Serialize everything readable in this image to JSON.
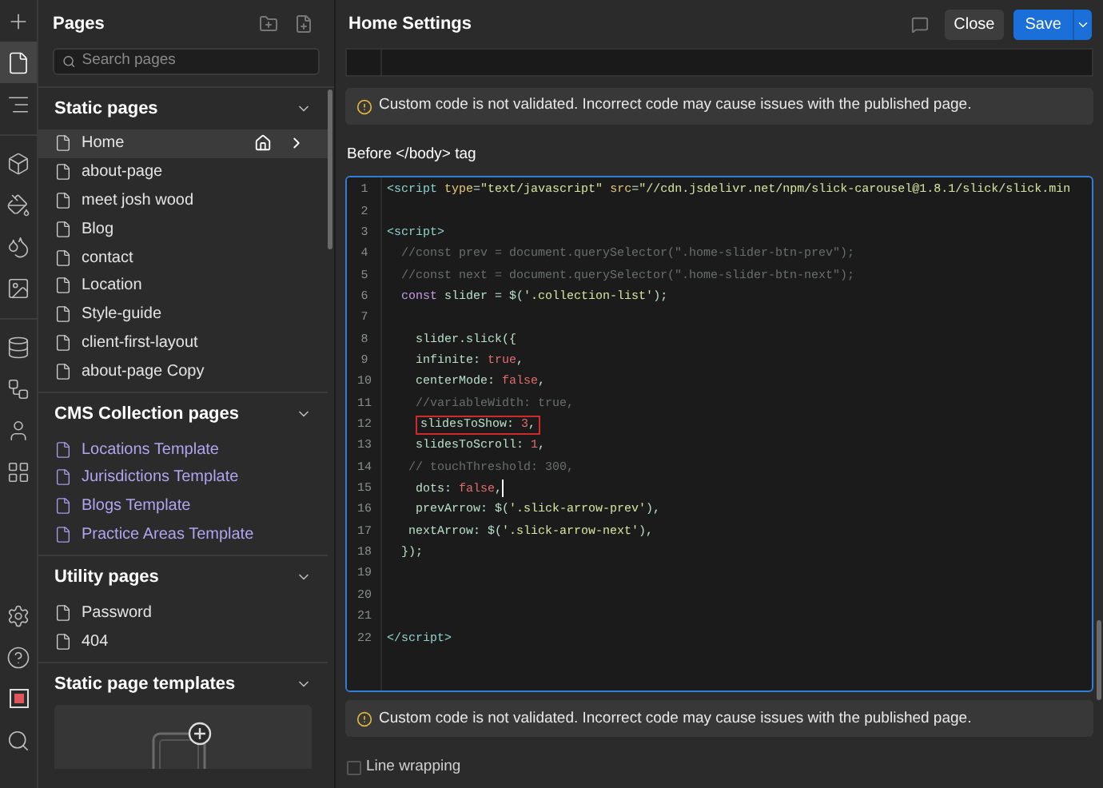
{
  "rail": [
    {
      "selected": false
    },
    {
      "selected": true
    },
    {
      "selected": false
    },
    {
      "selected": false
    },
    {
      "selected": false
    },
    {
      "selected": false
    },
    {
      "selected": false
    },
    {
      "selected": false
    },
    {
      "selected": false
    },
    {
      "selected": false
    },
    {
      "selected": false
    },
    {
      "selected": false
    },
    {
      "selected": false
    },
    {
      "selected": false
    },
    {
      "selected": false
    }
  ],
  "pages_panel": {
    "title": "Pages",
    "search": {
      "placeholder": "Search pages"
    },
    "sections": [
      {
        "title": "Static pages",
        "kind": "static",
        "items": [
          {
            "label": "Home",
            "selected": true
          },
          {
            "label": "about-page",
            "selected": false
          },
          {
            "label": "meet josh wood",
            "selected": false
          },
          {
            "label": "Blog",
            "selected": false
          },
          {
            "label": "contact",
            "selected": false
          },
          {
            "label": "Location",
            "selected": false
          },
          {
            "label": "Style-guide",
            "selected": false
          },
          {
            "label": "client-first-layout",
            "selected": false
          },
          {
            "label": "about-page Copy",
            "selected": false
          }
        ]
      },
      {
        "title": "CMS Collection pages",
        "kind": "cms",
        "items": [
          {
            "label": "Locations Template",
            "selected": false
          },
          {
            "label": "Jurisdictions Template",
            "selected": false
          },
          {
            "label": "Blogs Template",
            "selected": false
          },
          {
            "label": "Practice Areas Template",
            "selected": false
          }
        ]
      },
      {
        "title": "Utility pages",
        "kind": "static",
        "items": [
          {
            "label": "Password",
            "selected": false
          },
          {
            "label": "404",
            "selected": false
          }
        ]
      },
      {
        "title": "Static page templates",
        "kind": "templates"
      }
    ]
  },
  "settings": {
    "title": "Home Settings",
    "buttons": {
      "close": "Close",
      "save": "Save"
    },
    "top_notice": "Custom code is not validated. Incorrect code may cause issues with the published page.",
    "section_label": "Before </body> tag",
    "code_lines": [
      {
        "n": "1",
        "highlighted": false,
        "cursor": false,
        "tokens": [
          {
            "kind": "tag",
            "text": "<script "
          },
          {
            "kind": "attr",
            "text": "type"
          },
          {
            "kind": "plain",
            "text": "="
          },
          {
            "kind": "str",
            "text": "\"text/javascript\" "
          },
          {
            "kind": "attr",
            "text": "src"
          },
          {
            "kind": "plain",
            "text": "="
          },
          {
            "kind": "str",
            "text": "\"//cdn.jsdelivr.net/npm/slick-carousel@1.8.1/slick/slick.min"
          }
        ]
      },
      {
        "n": "2",
        "highlighted": false,
        "cursor": false
      },
      {
        "n": "3",
        "highlighted": false,
        "cursor": false,
        "tokens": [
          {
            "kind": "tag",
            "text": "<script>"
          }
        ]
      },
      {
        "n": "4",
        "highlighted": false,
        "cursor": false,
        "tokens": [
          {
            "kind": "comment",
            "text": "  //const prev = document.querySelector(\".home-slider-btn-prev\");"
          }
        ]
      },
      {
        "n": "5",
        "highlighted": false,
        "cursor": false,
        "tokens": [
          {
            "kind": "comment",
            "text": "  //const next = document.querySelector(\".home-slider-btn-next\");"
          }
        ]
      },
      {
        "n": "6",
        "highlighted": false,
        "cursor": false,
        "tokens": [
          {
            "kind": "keyword",
            "text": "  const"
          },
          {
            "kind": "plain",
            "text": " slider = $("
          },
          {
            "kind": "str",
            "text": "'.collection-list'"
          },
          {
            "kind": "plain",
            "text": ");"
          }
        ]
      },
      {
        "n": "7",
        "highlighted": false,
        "cursor": false
      },
      {
        "n": "8",
        "highlighted": false,
        "cursor": false,
        "tokens": [
          {
            "kind": "plain",
            "text": "    slider.slick({"
          }
        ]
      },
      {
        "n": "9",
        "highlighted": false,
        "cursor": false,
        "tokens": [
          {
            "kind": "plain",
            "text": "    infinite: "
          },
          {
            "kind": "bool",
            "text": "true"
          },
          {
            "kind": "plain",
            "text": ","
          }
        ]
      },
      {
        "n": "10",
        "highlighted": false,
        "cursor": false,
        "tokens": [
          {
            "kind": "plain",
            "text": "    centerMode: "
          },
          {
            "kind": "bool",
            "text": "false"
          },
          {
            "kind": "plain",
            "text": ","
          }
        ]
      },
      {
        "n": "11",
        "highlighted": false,
        "cursor": false,
        "tokens": [
          {
            "kind": "comment",
            "text": "    //variableWidth: true,"
          }
        ]
      },
      {
        "n": "12",
        "highlighted": true,
        "cursor": false,
        "tokens": [
          {
            "kind": "plain",
            "text": "    slidesToShow: "
          },
          {
            "kind": "num",
            "text": "3"
          },
          {
            "kind": "plain",
            "text": ","
          }
        ]
      },
      {
        "n": "13",
        "highlighted": false,
        "cursor": false,
        "tokens": [
          {
            "kind": "plain",
            "text": "    slidesToScroll: "
          },
          {
            "kind": "num",
            "text": "1"
          },
          {
            "kind": "plain",
            "text": ","
          }
        ]
      },
      {
        "n": "14",
        "highlighted": false,
        "cursor": false,
        "tokens": [
          {
            "kind": "comment",
            "text": "   // touchThreshold: 300,"
          }
        ]
      },
      {
        "n": "15",
        "highlighted": false,
        "cursor": true,
        "tokens": [
          {
            "kind": "plain",
            "text": "    dots: "
          },
          {
            "kind": "bool",
            "text": "false"
          },
          {
            "kind": "plain",
            "text": ","
          }
        ]
      },
      {
        "n": "16",
        "highlighted": false,
        "cursor": false,
        "tokens": [
          {
            "kind": "plain",
            "text": "    prevArrow: $("
          },
          {
            "kind": "str",
            "text": "'.slick-arrow-prev'"
          },
          {
            "kind": "plain",
            "text": "),"
          }
        ]
      },
      {
        "n": "17",
        "highlighted": false,
        "cursor": false,
        "tokens": [
          {
            "kind": "plain",
            "text": "   nextArrow: $("
          },
          {
            "kind": "str",
            "text": "'.slick-arrow-next'"
          },
          {
            "kind": "plain",
            "text": "),"
          }
        ]
      },
      {
        "n": "18",
        "highlighted": false,
        "cursor": false,
        "tokens": [
          {
            "kind": "plain",
            "text": "  });"
          }
        ]
      },
      {
        "n": "19",
        "highlighted": false,
        "cursor": false
      },
      {
        "n": "20",
        "highlighted": false,
        "cursor": false
      },
      {
        "n": "21",
        "highlighted": false,
        "cursor": false
      },
      {
        "n": "22",
        "highlighted": false,
        "cursor": false,
        "tokens": [
          {
            "kind": "tag",
            "text": "</script>"
          }
        ]
      }
    ],
    "bottom_notice": "Custom code is not validated. Incorrect code may cause issues with the published page.",
    "line_wrapping": {
      "label": "Line wrapping",
      "checked": false
    }
  }
}
